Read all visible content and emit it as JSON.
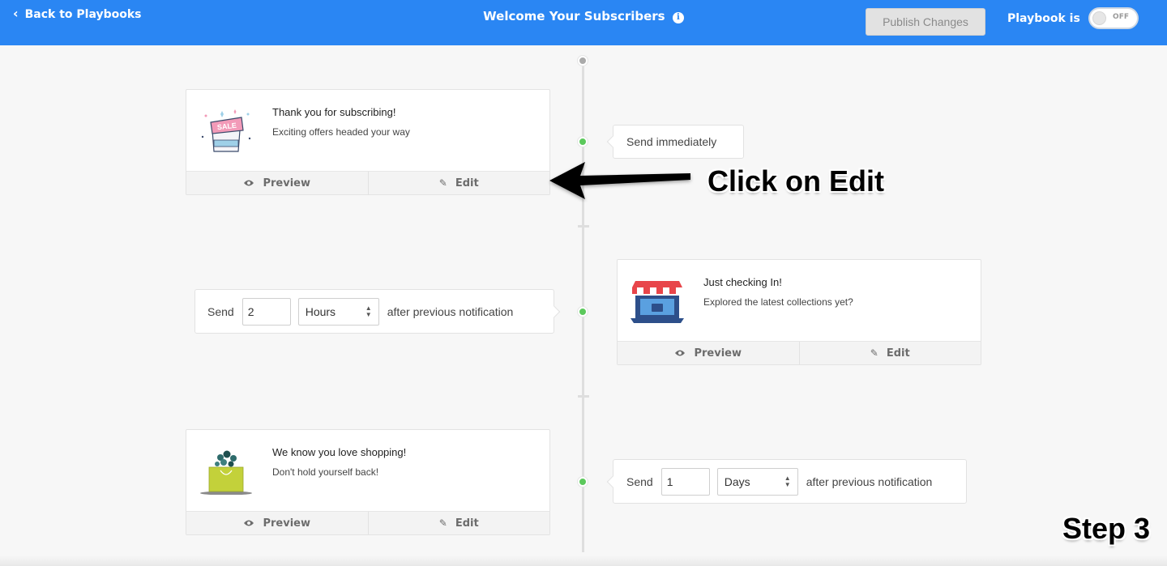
{
  "header": {
    "back_label": "Back to Playbooks",
    "title": "Welcome Your Subscribers",
    "info_glyph": "i",
    "publish_label": "Publish Changes",
    "playbook_label": "Playbook is",
    "toggle_state": "OFF",
    "bg_color": "#2a86f3"
  },
  "timeline": {
    "start_dot_color": "#aaaaaa",
    "step_dot_color": "#5cc95c"
  },
  "notifications": [
    {
      "title": "Thank you for subscribing!",
      "subtitle": "Exciting offers headed your way",
      "icon": "sale-box-icon",
      "preview_label": "Preview",
      "edit_label": "Edit"
    },
    {
      "title": "Just checking In!",
      "subtitle": "Explored the latest collections yet?",
      "icon": "online-store-icon",
      "preview_label": "Preview",
      "edit_label": "Edit"
    },
    {
      "title": "We know you love shopping!",
      "subtitle": "Don't hold yourself back!",
      "icon": "shopping-bag-icon",
      "preview_label": "Preview",
      "edit_label": "Edit"
    }
  ],
  "delays": [
    {
      "text": "Send immediately"
    },
    {
      "send_label": "Send",
      "value": "2",
      "unit": "Hours",
      "suffix": "after previous notification"
    },
    {
      "send_label": "Send",
      "value": "1",
      "unit": "Days",
      "suffix": "after previous notification"
    }
  ],
  "annotations": {
    "callout": "Click on Edit",
    "step": "Step 3"
  }
}
